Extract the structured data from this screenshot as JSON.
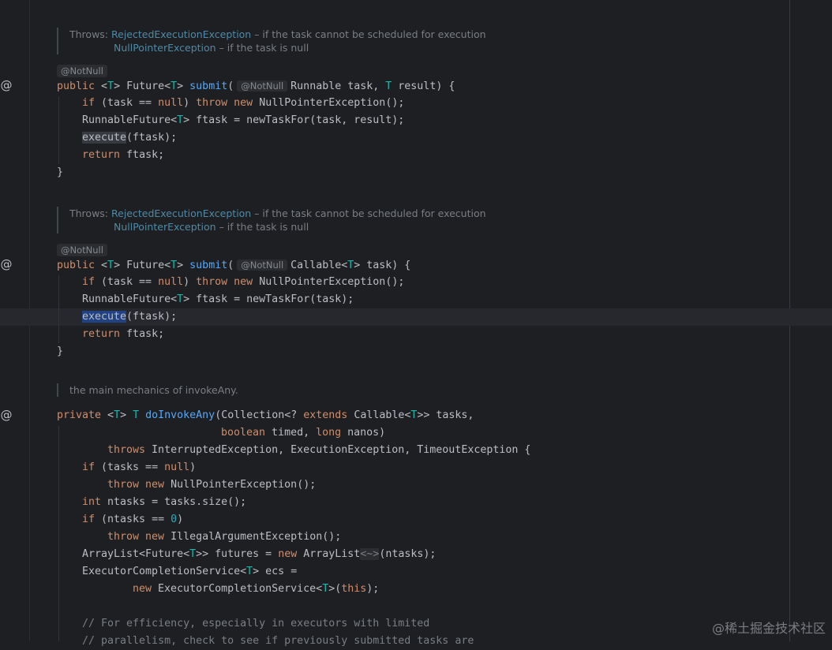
{
  "editor": {
    "override_marker": "@",
    "annotation_notnull": "@NotNull",
    "watermark": "@稀土掘金技术社区"
  },
  "doc1": {
    "throws_label": "Throws: ",
    "ex1": "RejectedExecutionException",
    "ex1_desc": " – if the task cannot be scheduled for execution",
    "ex2": "NullPointerException",
    "ex2_desc": " – if the task is null"
  },
  "doc2": {
    "throws_label": "Throws: ",
    "ex1": "RejectedExecutionException",
    "ex1_desc": " – if the task cannot be scheduled for execution",
    "ex2": "NullPointerException",
    "ex2_desc": " – if the task is null"
  },
  "doc3": {
    "text": "the main mechanics of invokeAny."
  },
  "code": {
    "m1_l1_a": "public",
    "m1_l1_b": " <",
    "m1_l1_c": "T",
    "m1_l1_d": "> Future<",
    "m1_l1_e": "T",
    "m1_l1_f": "> ",
    "m1_l1_g": "submit",
    "m1_l1_h": "(",
    "m1_l1_i": "Runnable task, ",
    "m1_l1_j": "T",
    "m1_l1_k": " result) {",
    "m1_l2": [
      "if",
      " (task == ",
      "null",
      ") ",
      "throw",
      " ",
      "new",
      " NullPointerException();"
    ],
    "m1_l3_a": "RunnableFuture<",
    "m1_l3_b": "T",
    "m1_l3_c": "> ftask = newTaskFor(task, result);",
    "m1_l4_a": "execute",
    "m1_l4_b": "(ftask);",
    "m1_l5_a": "return",
    "m1_l5_b": " ftask;",
    "m1_l6": "}",
    "m2_l1_i": "Callable<",
    "m2_l1_j": "T",
    "m2_l1_k": "> task) {",
    "m2_l3_c": "> ftask = newTaskFor(task);",
    "m3_l1": [
      "private",
      " <",
      "T",
      "> ",
      "T",
      " ",
      "doInvokeAny",
      "(Collection<? ",
      "extends",
      " Callable<",
      "T",
      ">> tasks,"
    ],
    "m3_l2": [
      "boolean",
      " timed, ",
      "long",
      " nanos)"
    ],
    "m3_l3": [
      "throws",
      " InterruptedException, ExecutionException, TimeoutException {"
    ],
    "m3_l4": [
      "if",
      " (tasks == ",
      "null",
      ")"
    ],
    "m3_l5": [
      "throw",
      " ",
      "new",
      " NullPointerException();"
    ],
    "m3_l6": [
      "int",
      " ntasks = tasks.size();"
    ],
    "m3_l7": [
      "if",
      " (ntasks == ",
      "0",
      ")"
    ],
    "m3_l8": [
      "throw",
      " ",
      "new",
      " IllegalArgumentException();"
    ],
    "m3_l9": [
      "ArrayList<Future<",
      "T",
      ">> futures = ",
      "new",
      " ArrayList",
      "<~>",
      "(ntasks);"
    ],
    "m3_l10": [
      "ExecutorCompletionService<",
      "T",
      "> ecs ="
    ],
    "m3_l11": [
      "new",
      " ExecutorCompletionService<",
      "T",
      ">(",
      "this",
      ");"
    ],
    "c1": "// For efficiency, especially in executors with limited",
    "c2": "// parallelism, check to see if previously submitted tasks are"
  }
}
